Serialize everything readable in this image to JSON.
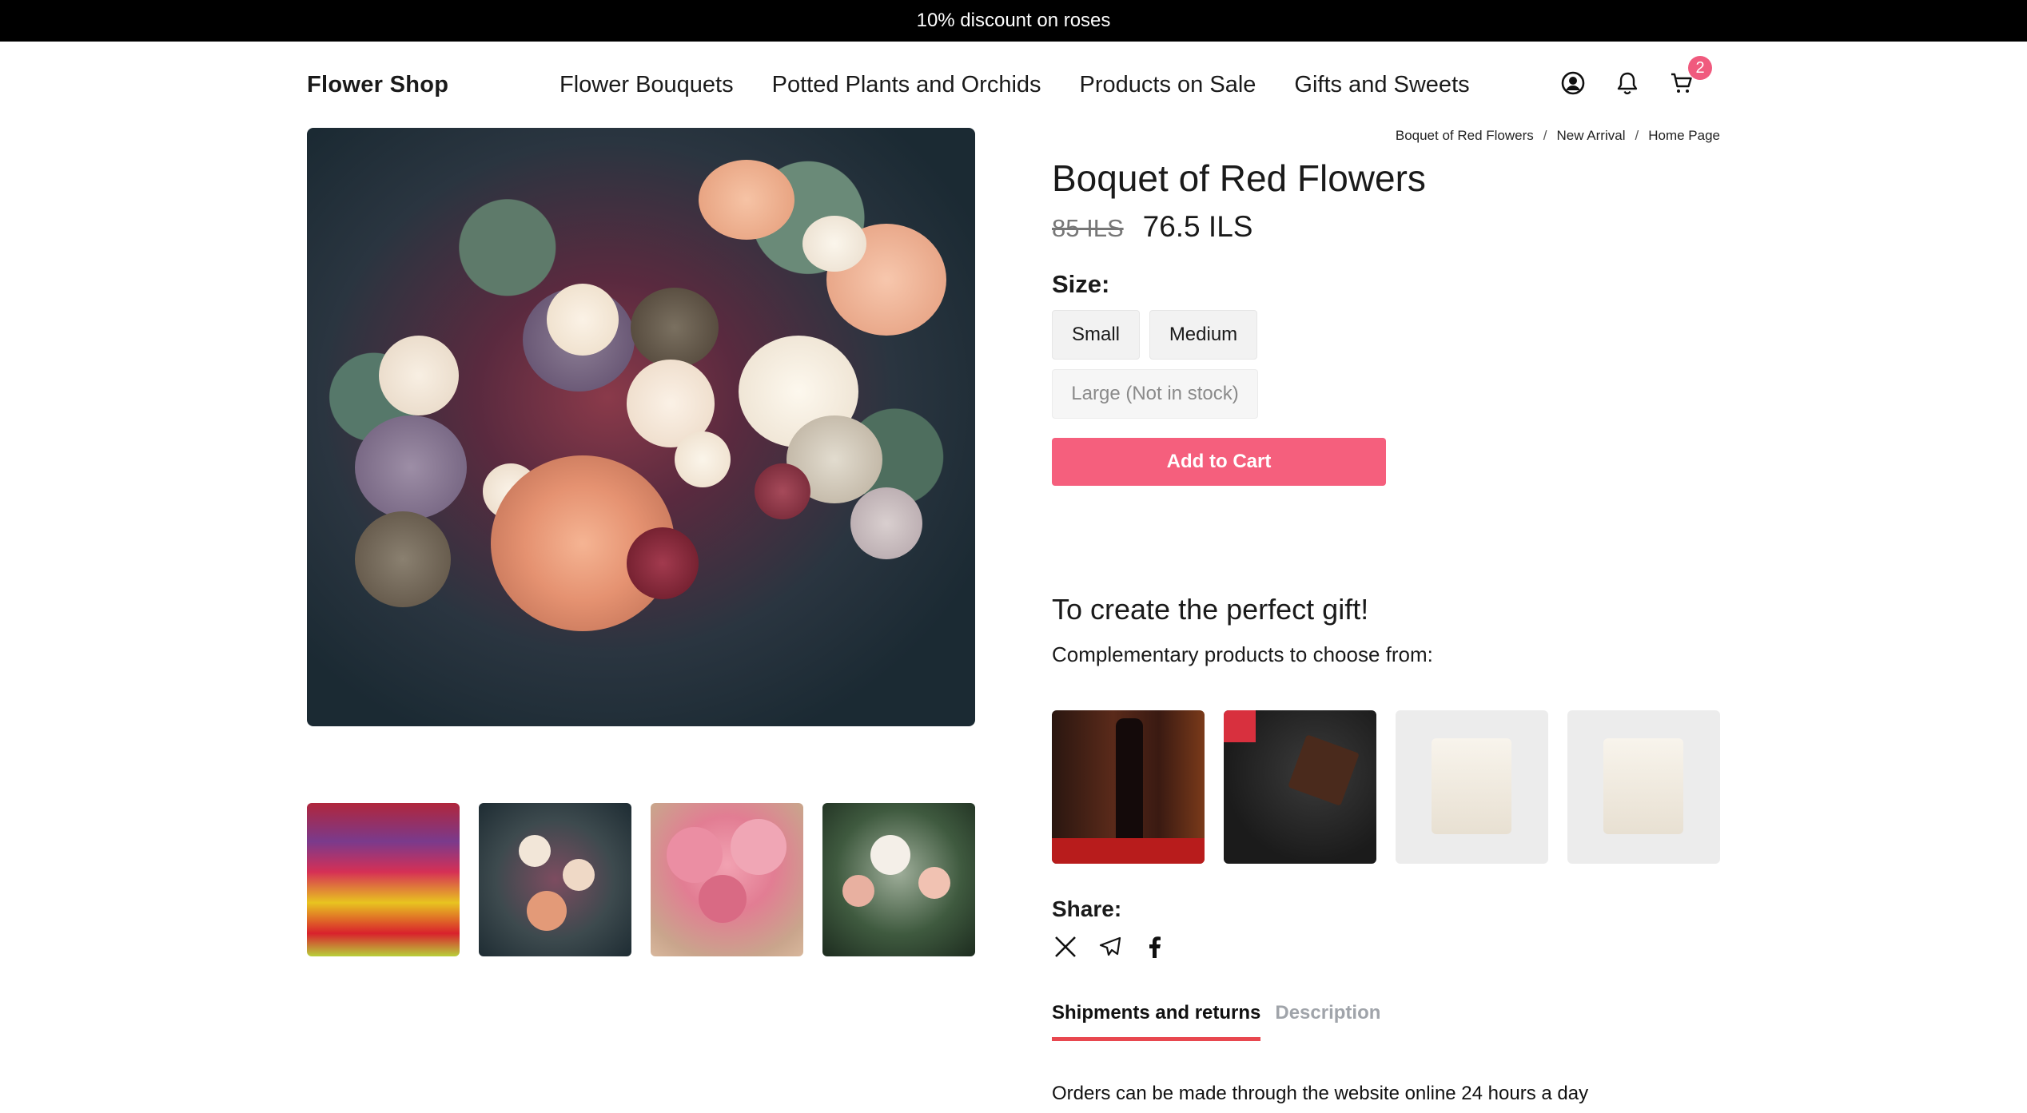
{
  "announcement": "10% discount on roses",
  "header": {
    "logo": "Flower Shop",
    "nav": [
      "Flower Bouquets",
      "Potted Plants and Orchids",
      "Products on Sale",
      "Gifts and Sweets"
    ],
    "icons": [
      "user-circle-icon",
      "bell-icon",
      "cart-icon"
    ],
    "cart_count": "2"
  },
  "breadcrumb": [
    "Boquet of Red Flowers",
    "New Arrival",
    "Home Page"
  ],
  "breadcrumb_separator": "/",
  "product": {
    "title": "Boquet of Red Flowers",
    "old_price": "85 ILS",
    "price": "76.5 ILS",
    "size_label": "Size:",
    "sizes": [
      "Small",
      "Medium",
      "Large (Not in stock)"
    ],
    "add_to_cart": "Add to Cart"
  },
  "gifts": {
    "heading": "To create the perfect gift!",
    "subheading": "Complementary products to choose from:",
    "items": [
      "wine-bottle-image",
      "dark-chocolate-image",
      "white-chocolate-image",
      "white-chocolate-image"
    ]
  },
  "share": {
    "label": "Share:",
    "icons": [
      "x-icon",
      "telegram-icon",
      "facebook-icon"
    ]
  },
  "tabs": {
    "items": [
      "Shipments and returns",
      "Description"
    ],
    "active": "Shipments and returns",
    "content": "Orders can be made through the website online 24 hours a day"
  },
  "colors": {
    "accent": "#f55f7d",
    "tab_underline": "#e8474f",
    "announcement_bg": "#000000"
  }
}
